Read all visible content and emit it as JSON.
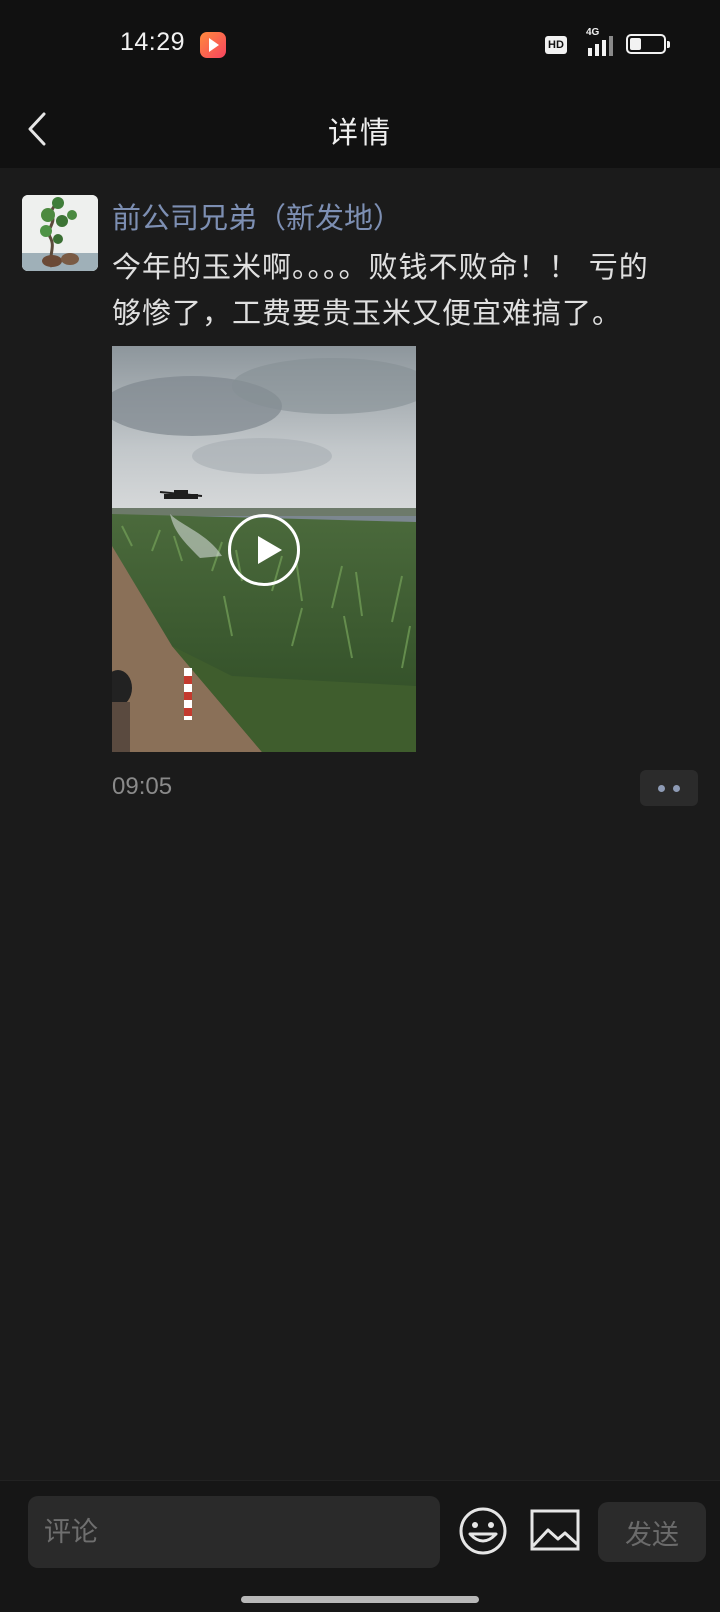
{
  "status_bar": {
    "time": "14:29",
    "hd": "HD",
    "network": "4G",
    "battery_level": 0.35
  },
  "header": {
    "title": "详情",
    "back_icon": "chevron-left-icon"
  },
  "post": {
    "author": "前公司兄弟（新发地）",
    "text": "今年的玉米啊。。。。败钱不败命！！ 亏的够惨了，工费要贵玉米又便宜难搞了。",
    "time": "09:05"
  },
  "composer": {
    "placeholder": "评论",
    "send_label": "发送",
    "emoji_icon": "emoji-icon",
    "image_icon": "image-icon"
  },
  "colors": {
    "background": "#1b1b1b",
    "bar": "#111111",
    "author": "#7d8fb3",
    "text": "#e0e0e0",
    "muted": "#8a8a8a"
  }
}
